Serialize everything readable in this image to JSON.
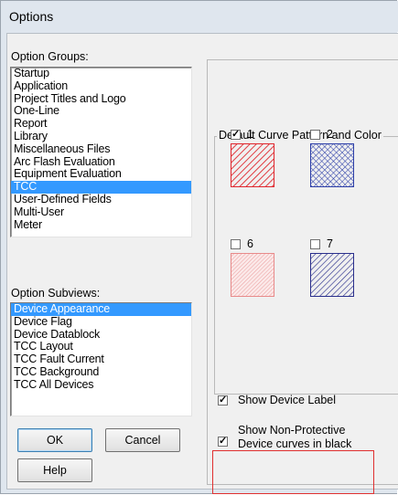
{
  "window": {
    "title": "Options"
  },
  "option_groups": {
    "label": "Option Groups:",
    "items": [
      {
        "label": "Startup",
        "selected": false
      },
      {
        "label": "Application",
        "selected": false
      },
      {
        "label": "Project Titles and Logo",
        "selected": false
      },
      {
        "label": "One-Line",
        "selected": false
      },
      {
        "label": "Report",
        "selected": false
      },
      {
        "label": "Library",
        "selected": false
      },
      {
        "label": "Miscellaneous Files",
        "selected": false
      },
      {
        "label": "Arc Flash Evaluation",
        "selected": false
      },
      {
        "label": "Equipment Evaluation",
        "selected": false
      },
      {
        "label": "TCC",
        "selected": true
      },
      {
        "label": "User-Defined Fields",
        "selected": false
      },
      {
        "label": "Multi-User",
        "selected": false
      },
      {
        "label": "Meter",
        "selected": false
      }
    ]
  },
  "option_subviews": {
    "label": "Option Subviews:",
    "items": [
      {
        "label": "Device Appearance",
        "selected": true
      },
      {
        "label": "Device Flag",
        "selected": false
      },
      {
        "label": "Device Datablock",
        "selected": false
      },
      {
        "label": "TCC Layout",
        "selected": false
      },
      {
        "label": "TCC Fault Current",
        "selected": false
      },
      {
        "label": "TCC Background",
        "selected": false
      },
      {
        "label": "TCC All Devices",
        "selected": false
      }
    ]
  },
  "buttons": {
    "ok": "OK",
    "cancel": "Cancel",
    "help": "Help"
  },
  "curve_patterns": {
    "title": "Default Curve Pattern and Color",
    "items": [
      {
        "number": "1",
        "checked": true,
        "color": "#e0262d",
        "pattern": "diagonal-right"
      },
      {
        "number": "2",
        "checked": false,
        "color": "#2d3fa8",
        "pattern": "crosshatch"
      },
      {
        "number": "6",
        "checked": false,
        "color": "#e88a8a",
        "pattern": "dense-diagonal-right"
      },
      {
        "number": "7",
        "checked": false,
        "color": "#2a2f8c",
        "pattern": "diagonal-right"
      }
    ]
  },
  "options": {
    "show_device_label": {
      "label": "Show Device Label",
      "checked": true
    },
    "show_non_protective": {
      "label_line1": "Show Non-Protective",
      "label_line2": "Device curves in black",
      "checked": true
    }
  },
  "colors": {
    "selection": "#3399ff",
    "highlight_box": "#e03030"
  }
}
